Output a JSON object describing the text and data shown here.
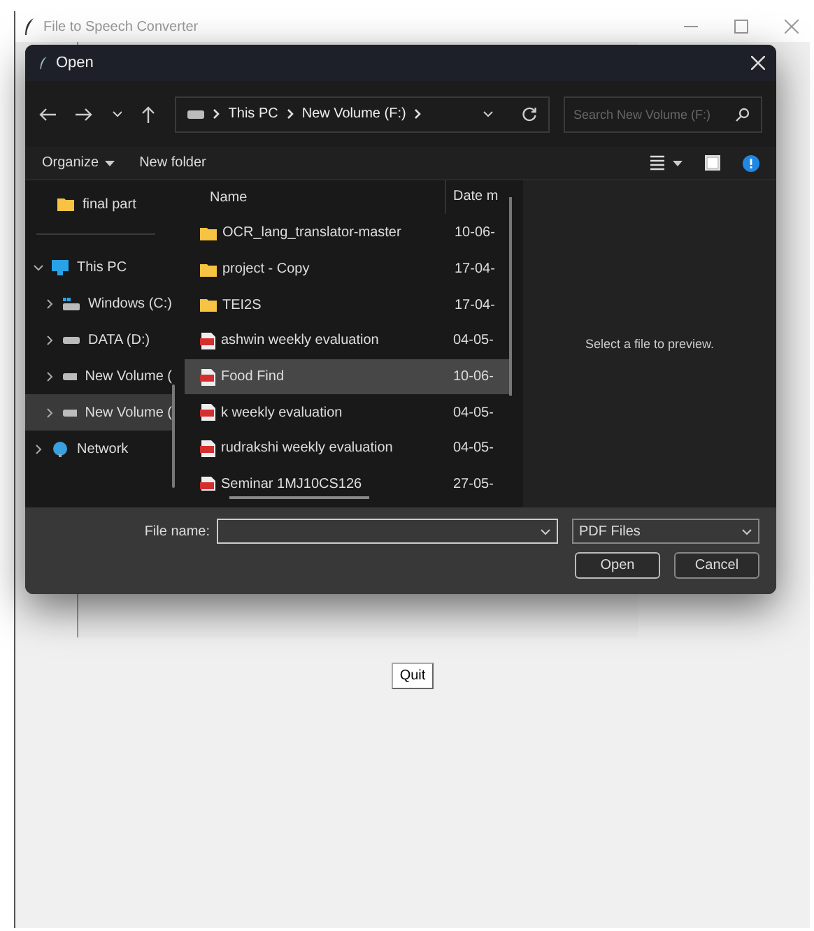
{
  "window": {
    "title": "File to Speech Converter"
  },
  "dialog": {
    "title": "Open",
    "breadcrumb": [
      "This PC",
      "New Volume (F:)"
    ],
    "search": {
      "placeholder": "Search New Volume (F:)"
    },
    "toolbar": [
      "Organize",
      "New folder"
    ],
    "quick_access": [
      {
        "label": "final part"
      }
    ],
    "nav": [
      {
        "label": "This PC",
        "kind": "pc",
        "expanded": true,
        "selected": false,
        "children": [
          {
            "label": "Windows (C:)",
            "kind": "windows",
            "expanded": false,
            "selected": false
          },
          {
            "label": "DATA (D:)",
            "kind": "drive",
            "expanded": false,
            "selected": false
          },
          {
            "label": "New Volume (",
            "kind": "drive",
            "expanded": false,
            "selected": false
          },
          {
            "label": "New Volume (",
            "kind": "drive",
            "expanded": false,
            "selected": true
          }
        ]
      },
      {
        "label": "Network",
        "kind": "network",
        "expanded": false,
        "selected": false
      }
    ],
    "columns": [
      "Name",
      "Date m"
    ],
    "files": [
      {
        "name": "OCR_lang_translator-master",
        "date": "10-06-",
        "kind": "folder",
        "selected": false
      },
      {
        "name": "project - Copy",
        "date": "17-04-",
        "kind": "folder",
        "selected": false
      },
      {
        "name": "TEI2S",
        "date": "17-04-",
        "kind": "folder",
        "selected": false
      },
      {
        "name": "ashwin weekly evaluation",
        "date": "04-05-",
        "kind": "pdf",
        "selected": false
      },
      {
        "name": "Food Find",
        "date": "10-06-",
        "kind": "pdf",
        "selected": true
      },
      {
        "name": "k weekly evaluation",
        "date": "04-05-",
        "kind": "pdf",
        "selected": false
      },
      {
        "name": "rudrakshi weekly evaluation",
        "date": "04-05-",
        "kind": "pdf",
        "selected": false
      },
      {
        "name": "Seminar 1MJ10CS126",
        "date": "27-05-",
        "kind": "pdf",
        "selected": false
      }
    ],
    "preview": "Select a file to preview.",
    "file_name_label": "File name:",
    "file_type": "PDF Files",
    "buttons": [
      "Open",
      "Cancel"
    ]
  },
  "quit_button": "Quit"
}
